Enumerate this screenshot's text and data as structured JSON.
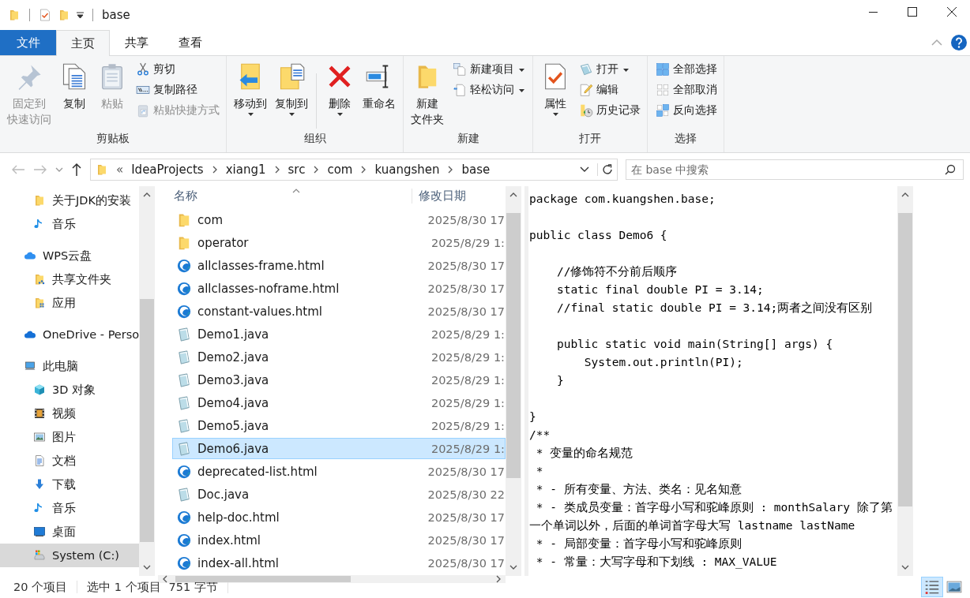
{
  "title_bar": {
    "title": "base"
  },
  "ribbon_tabs": [
    {
      "kind": "menu",
      "label": "文件",
      "selected": false
    },
    {
      "kind": "tab",
      "label": "主页",
      "selected": true
    },
    {
      "kind": "tab",
      "label": "共享",
      "selected": false
    },
    {
      "kind": "tab",
      "label": "查看",
      "selected": false
    }
  ],
  "ribbon_groups": [
    {
      "label": "剪贴板",
      "large": [
        {
          "kind": "pin",
          "label_lines": [
            "固定到",
            "快速访问"
          ],
          "disabled": true,
          "dropdown": false,
          "divider_before": false
        },
        {
          "kind": "copy",
          "label_lines": [
            "复制"
          ],
          "disabled": false,
          "dropdown": false,
          "divider_before": false
        },
        {
          "kind": "paste",
          "label_lines": [
            "粘贴"
          ],
          "disabled": true,
          "dropdown": false,
          "divider_before": false
        }
      ],
      "small": [
        {
          "kind": "cut",
          "label": "剪切",
          "disabled": false,
          "dropdown": false
        },
        {
          "kind": "copy-path",
          "label": "复制路径",
          "disabled": false,
          "dropdown": false
        },
        {
          "kind": "paste-shortcut",
          "label": "粘贴快捷方式",
          "disabled": true,
          "dropdown": false
        }
      ]
    },
    {
      "label": "组织",
      "large": [
        {
          "kind": "move-to",
          "label_lines": [
            "移动到"
          ],
          "disabled": false,
          "dropdown": true,
          "divider_before": false
        },
        {
          "kind": "copy-to",
          "label_lines": [
            "复制到"
          ],
          "disabled": false,
          "dropdown": true,
          "divider_before": false
        },
        {
          "kind": "delete",
          "label_lines": [
            "删除"
          ],
          "disabled": false,
          "dropdown": true,
          "divider_before": true
        },
        {
          "kind": "rename",
          "label_lines": [
            "重命名"
          ],
          "disabled": false,
          "dropdown": false,
          "divider_before": false
        }
      ]
    },
    {
      "label": "新建",
      "large": [
        {
          "kind": "new-folder",
          "label_lines": [
            "新建",
            "文件夹"
          ],
          "disabled": false,
          "dropdown": false,
          "divider_before": false
        }
      ],
      "small": [
        {
          "kind": "new-item",
          "label": "新建项目",
          "disabled": false,
          "dropdown": true
        },
        {
          "kind": "easy-access",
          "label": "轻松访问",
          "disabled": false,
          "dropdown": true
        }
      ]
    },
    {
      "label": "打开",
      "large": [
        {
          "kind": "properties",
          "label_lines": [
            "属性"
          ],
          "disabled": false,
          "dropdown": true,
          "divider_before": false
        }
      ],
      "small": [
        {
          "kind": "open",
          "label": "打开",
          "disabled": false,
          "dropdown": true
        },
        {
          "kind": "edit",
          "label": "编辑",
          "disabled": false,
          "dropdown": false
        },
        {
          "kind": "history",
          "label": "历史记录",
          "disabled": false,
          "dropdown": false
        }
      ]
    },
    {
      "label": "选择",
      "small": [
        {
          "kind": "select-all",
          "label": "全部选择",
          "disabled": false,
          "dropdown": false
        },
        {
          "kind": "select-none",
          "label": "全部取消",
          "disabled": false,
          "dropdown": false
        },
        {
          "kind": "invert",
          "label": "反向选择",
          "disabled": false,
          "dropdown": false
        }
      ]
    }
  ],
  "navigation": {
    "back": {
      "disabled": true
    },
    "forward": {
      "disabled": true
    },
    "up": {
      "disabled": false
    }
  },
  "address": {
    "overflow": "«",
    "breadcrumb": [
      "IdeaProjects",
      "xiang1",
      "src",
      "com",
      "kuangshen",
      "base"
    ]
  },
  "search": {
    "placeholder": "在 base 中搜索"
  },
  "nav_pane": [
    {
      "children": [
        {
          "kind": "folder",
          "label": "关于JDK的安装",
          "selected": false
        },
        {
          "kind": "music",
          "label": "音乐",
          "selected": false
        }
      ]
    },
    {
      "kind": "cloud",
      "label": "WPS云盘",
      "selected": false,
      "children": [
        {
          "kind": "shared-folder",
          "label": "共享文件夹",
          "selected": false
        },
        {
          "kind": "apps-folder",
          "label": "应用",
          "selected": false
        }
      ]
    },
    {
      "kind": "onedrive",
      "label": "OneDrive - Perso",
      "selected": false
    },
    {
      "kind": "computer",
      "label": "此电脑",
      "selected": false,
      "children": [
        {
          "kind": "cube",
          "label": "3D 对象",
          "selected": false
        },
        {
          "kind": "video",
          "label": "视频",
          "selected": false
        },
        {
          "kind": "picture",
          "label": "图片",
          "selected": false
        },
        {
          "kind": "document",
          "label": "文档",
          "selected": false
        },
        {
          "kind": "download",
          "label": "下载",
          "selected": false
        },
        {
          "kind": "music",
          "label": "音乐",
          "selected": false
        },
        {
          "kind": "desktop",
          "label": "桌面",
          "selected": false
        },
        {
          "kind": "drive",
          "label": "System (C:)",
          "selected": true
        }
      ]
    }
  ],
  "file_list": {
    "columns": [
      "名称",
      "修改日期"
    ],
    "rows": [
      {
        "kind": "folder",
        "name": "com",
        "date": "2025/8/30 17",
        "selected": false
      },
      {
        "kind": "folder",
        "name": "operator",
        "date": "2025/8/29 1:",
        "selected": false
      },
      {
        "kind": "html",
        "name": "allclasses-frame.html",
        "date": "2025/8/30 17",
        "selected": false
      },
      {
        "kind": "html",
        "name": "allclasses-noframe.html",
        "date": "2025/8/30 17",
        "selected": false
      },
      {
        "kind": "html",
        "name": "constant-values.html",
        "date": "2025/8/30 17",
        "selected": false
      },
      {
        "kind": "java",
        "name": "Demo1.java",
        "date": "2025/8/29 1:",
        "selected": false
      },
      {
        "kind": "java",
        "name": "Demo2.java",
        "date": "2025/8/29 1:",
        "selected": false
      },
      {
        "kind": "java",
        "name": "Demo3.java",
        "date": "2025/8/29 1:",
        "selected": false
      },
      {
        "kind": "java",
        "name": "Demo4.java",
        "date": "2025/8/29 1:",
        "selected": false
      },
      {
        "kind": "java",
        "name": "Demo5.java",
        "date": "2025/8/29 1:",
        "selected": false
      },
      {
        "kind": "java",
        "name": "Demo6.java",
        "date": "2025/8/29 1:",
        "selected": true
      },
      {
        "kind": "html",
        "name": "deprecated-list.html",
        "date": "2025/8/30 17",
        "selected": false
      },
      {
        "kind": "java",
        "name": "Doc.java",
        "date": "2025/8/30 22",
        "selected": false
      },
      {
        "kind": "html",
        "name": "help-doc.html",
        "date": "2025/8/30 17",
        "selected": false
      },
      {
        "kind": "html",
        "name": "index.html",
        "date": "2025/8/30 17",
        "selected": false
      },
      {
        "kind": "html",
        "name": "index-all.html",
        "date": "2025/8/30 17",
        "selected": false
      }
    ]
  },
  "preview": {
    "code": "package com.kuangshen.base;\n\npublic class Demo6 {\n\n    //修饰符不分前后顺序\n    static final double PI = 3.14;\n    //final static double PI = 3.14;两者之间没有区别\n\n    public static void main(String[] args) {\n        System.out.println(PI);\n    }\n\n}\n/**\n * 变量的命名规范\n *\n * - 所有变量、方法、类名：见名知意\n * - 类成员变量：首字母小写和驼峰原则 : monthSalary 除了第一个单词以外，后面的单词首字母大写 lastname lastName\n * - 局部变量：首字母小写和驼峰原则\n * - 常量：大写字母和下划线 : MAX_VALUE"
  },
  "status_bar": {
    "item_count": "20 个项目",
    "selection": "选中 1 个项目",
    "size": "751 字节"
  },
  "view_buttons": [
    {
      "kind": "details",
      "selected": true
    },
    {
      "kind": "large-icons",
      "selected": false
    }
  ]
}
